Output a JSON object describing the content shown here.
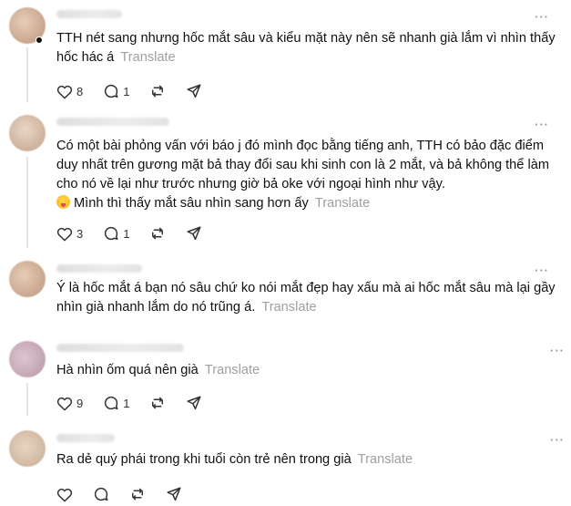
{
  "posts": [
    {
      "text": "TTH nét sang nhưng hốc mắt sâu và kiểu mặt này nên sẽ nhanh già lắm vì nhìn thấy hốc hác á",
      "translate": "Translate",
      "likes": "8",
      "replies": "1"
    },
    {
      "text": "Có một bài phỏng vấn với báo j đó mình đọc bằng tiếng anh, TTH có bảo đặc điểm duy nhất trên gương mặt bả thay đổi sau khi sinh con là 2 mắt, và bả không thể làm cho nó về lại như trước nhưng giờ bả oke với ngoại hình như vậy.",
      "text2": "Mình thì thấy mắt sâu nhìn sang hơn ấy",
      "translate": "Translate",
      "likes": "3",
      "replies": "1"
    },
    {
      "text": "Ý là hốc mắt á bạn nó sâu chứ ko nói mắt đẹp hay xấu mà ai hốc mắt sâu mà lại gầy nhìn già nhanh lắm do nó trũng á.",
      "translate": "Translate"
    },
    {
      "text": "Hà nhìn ốm quá nên già",
      "translate": "Translate",
      "likes": "9",
      "replies": "1"
    },
    {
      "text": "Ra dẻ quý phái trong khi tuổi còn trẻ nên trong già",
      "translate": "Translate"
    }
  ],
  "icons": {
    "like": "heart-icon",
    "reply": "comment-icon",
    "repost": "repost-icon",
    "share": "send-icon",
    "more": "more-icon"
  },
  "more_glyph": "···"
}
